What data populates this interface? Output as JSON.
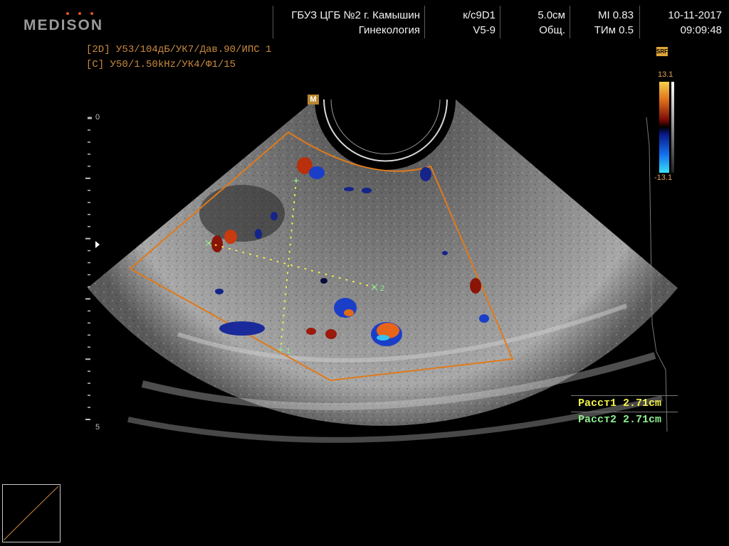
{
  "header": {
    "brand": "MEDISON",
    "institution": "ГБУЗ ЦГБ №2 г. Камышин",
    "department": "Гинекология",
    "probe_line1": "к/с9D1",
    "probe_line2": "V5-9",
    "depth": "5.0см",
    "preset": "Общ.",
    "mi": "MI  0.83",
    "tim": "ТИм 0.5",
    "date": "10-11-2017",
    "time": "09:09:48"
  },
  "params": {
    "line1_tag": "[2D]",
    "line1_value": " У53/104дБ/УК7/Дав.90/ИПС 1",
    "line2_tag": "[C]",
    "line2_value": " У50/1.50kHz/УК4/Ф1/15"
  },
  "depth_scale": {
    "top": "0",
    "bottom": "5"
  },
  "colorbar": {
    "max": "13.1",
    "min": "-13.1"
  },
  "icons": {
    "srf_label": "SRF",
    "m_label": "M"
  },
  "markers": {
    "cursor1": "1",
    "cursor2": "2"
  },
  "measurements": [
    {
      "label": "Расст1 2.71cm"
    },
    {
      "label": "Расст2 2.71cm"
    }
  ],
  "colors": {
    "roi": "#e07a1a",
    "caliper1": "#f3f34a",
    "caliper2": "#8ff08f",
    "text_params": "#c98a3c"
  }
}
